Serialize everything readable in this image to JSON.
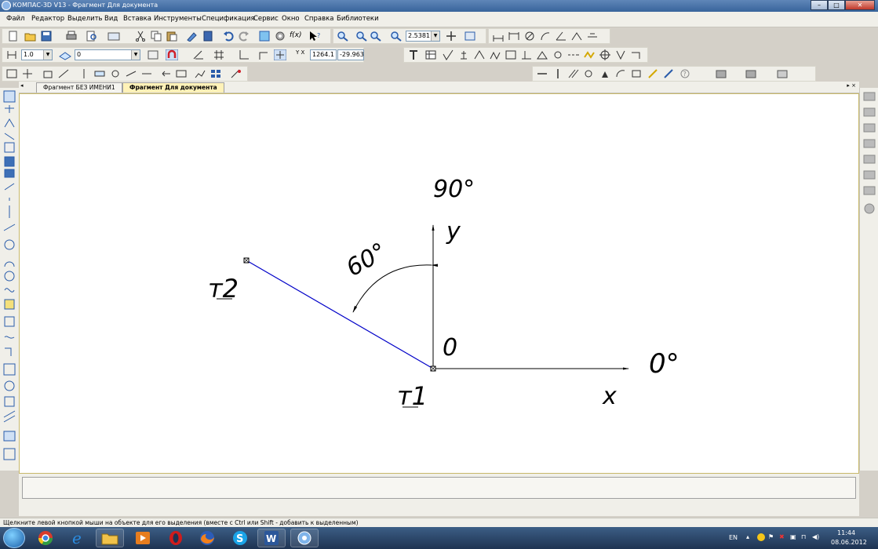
{
  "window": {
    "title": "КОМПАС-3D V13 - Фрагмент Для документа"
  },
  "menu": [
    "Файл",
    "Редактор",
    "Выделить",
    "Вид",
    "Вставка",
    "Инструменты",
    "Спецификация",
    "Сервис",
    "Окно",
    "Справка",
    "Библиотеки"
  ],
  "toolbar": {
    "zoom_value": "2.5381",
    "line_width": "1.0",
    "layer_value": "0",
    "coord_x": "1264.1",
    "coord_y": "-29.963"
  },
  "tabs": [
    {
      "label": "Фрагмент БЕЗ ИМЕНИ1",
      "active": false
    },
    {
      "label": "Фрагмент Для документа",
      "active": true
    }
  ],
  "drawing": {
    "label_90": "90°",
    "label_y": "y",
    "label_60": "60°",
    "label_t2": "т2",
    "label_o": "0",
    "label_0": "0°",
    "label_t1": "т1",
    "label_x": "x",
    "line_color": "#0000c8"
  },
  "status": {
    "hint": "Щелкните левой кнопкой мыши на объекте для его выделения (вместе с Ctrl или Shift - добавить к выделенным)"
  },
  "tray": {
    "lang": "EN",
    "time": "11:44",
    "date": "08.06.2012"
  }
}
